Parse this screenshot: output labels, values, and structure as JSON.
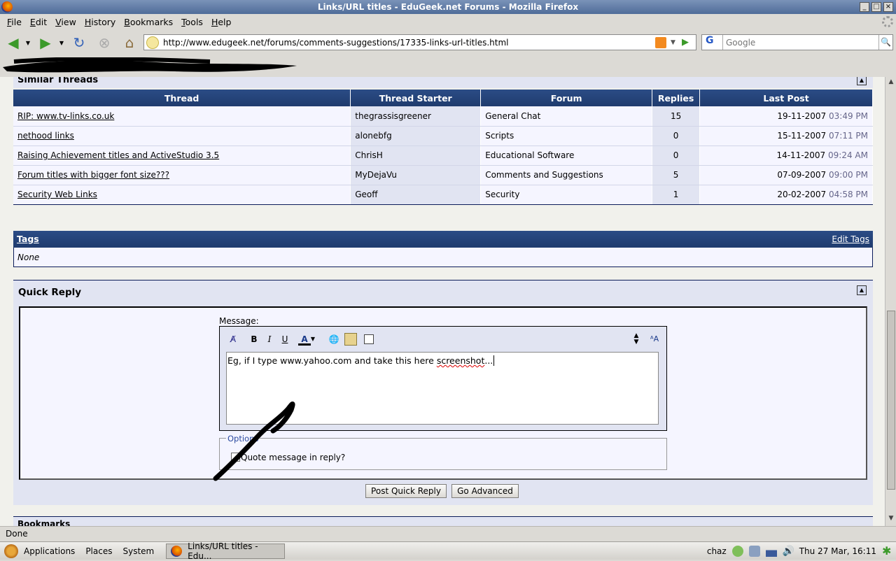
{
  "window": {
    "title": "Links/URL titles - EduGeek.net Forums - Mozilla Firefox"
  },
  "menu": [
    "File",
    "Edit",
    "View",
    "History",
    "Bookmarks",
    "Tools",
    "Help"
  ],
  "navbar": {
    "url": "http://www.edugeek.net/forums/comments-suggestions/17335-links-url-titles.html",
    "search_placeholder": "Google",
    "search_engine": "G"
  },
  "similar_threads": {
    "heading": "Similar Threads",
    "columns": [
      "Thread",
      "Thread Starter",
      "Forum",
      "Replies",
      "Last Post"
    ],
    "rows": [
      {
        "thread": "RIP: www.tv-links.co.uk",
        "starter": "thegrassisgreener",
        "forum": "General Chat",
        "replies": "15",
        "date": "19-11-2007",
        "time": "03:49 PM"
      },
      {
        "thread": "nethood links",
        "starter": "alonebfg",
        "forum": "Scripts",
        "replies": "0",
        "date": "15-11-2007",
        "time": "07:11 PM"
      },
      {
        "thread": "Raising Achievement titles and ActiveStudio 3.5",
        "starter": "ChrisH",
        "forum": "Educational Software",
        "replies": "0",
        "date": "14-11-2007",
        "time": "09:24 AM"
      },
      {
        "thread": "Forum titles with bigger font size???",
        "starter": "MyDejaVu",
        "forum": "Comments and Suggestions",
        "replies": "5",
        "date": "07-09-2007",
        "time": "09:00 PM"
      },
      {
        "thread": "Security Web Links",
        "starter": "Geoff",
        "forum": "Security",
        "replies": "1",
        "date": "20-02-2007",
        "time": "04:58 PM"
      }
    ]
  },
  "tags": {
    "heading": "Tags",
    "edit": "Edit Tags",
    "value": "None"
  },
  "quick_reply": {
    "heading": "Quick Reply",
    "message_label": "Message:",
    "message_text_before": "Eg, if I type www.yahoo.com and take this here ",
    "message_text_misspelled": "screenshot",
    "message_text_after": "...",
    "options_legend": "Options",
    "quote_label": "Quote message in reply?",
    "post_button": "Post Quick Reply",
    "advanced_button": "Go Advanced"
  },
  "bookmarks_heading": "Bookmarks",
  "status": "Done",
  "panel": {
    "applications": "Applications",
    "places": "Places",
    "system": "System",
    "task": "Links/URL titles - Edu...",
    "user": "chaz",
    "clock": "Thu 27 Mar, 16:11"
  }
}
